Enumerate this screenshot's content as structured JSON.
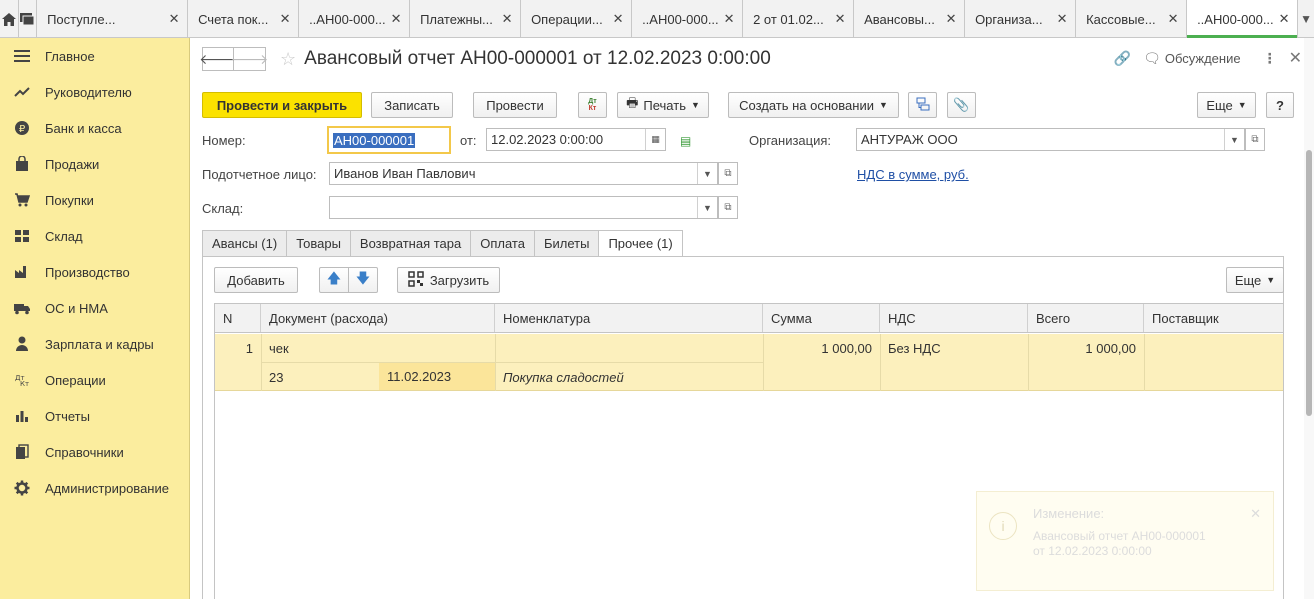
{
  "tabs": [
    {
      "label": "Поступле...",
      "width": 150
    },
    {
      "label": "Счета пок...",
      "width": 110
    },
    {
      "label": "..АН00-000...",
      "width": 110
    },
    {
      "label": "Платежны...",
      "width": 110
    },
    {
      "label": "Операции...",
      "width": 110
    },
    {
      "label": "..АН00-000...",
      "width": 110
    },
    {
      "label": "2 от 01.02...",
      "width": 110
    },
    {
      "label": "Авансовы...",
      "width": 110
    },
    {
      "label": "Организа...",
      "width": 110
    },
    {
      "label": "Кассовые...",
      "width": 110
    },
    {
      "label": "..АН00-000...",
      "width": 110,
      "active": true
    }
  ],
  "sidebar": {
    "items": [
      {
        "label": "Главное",
        "icon": "menu-icon"
      },
      {
        "label": "Руководителю",
        "icon": "trend-icon"
      },
      {
        "label": "Банк и касса",
        "icon": "ruble-icon"
      },
      {
        "label": "Продажи",
        "icon": "bag-icon"
      },
      {
        "label": "Покупки",
        "icon": "cart-icon"
      },
      {
        "label": "Склад",
        "icon": "warehouse-icon"
      },
      {
        "label": "Производство",
        "icon": "factory-icon"
      },
      {
        "label": "ОС и НМА",
        "icon": "truck-icon"
      },
      {
        "label": "Зарплата и кадры",
        "icon": "person-icon"
      },
      {
        "label": "Операции",
        "icon": "dt-kt-icon"
      },
      {
        "label": "Отчеты",
        "icon": "bar-chart-icon"
      },
      {
        "label": "Справочники",
        "icon": "books-icon"
      },
      {
        "label": "Администрирование",
        "icon": "gear-icon"
      }
    ]
  },
  "header": {
    "title": "Авансовый отчет АН00-000001 от 12.02.2023 0:00:00",
    "discuss": "Обсуждение"
  },
  "toolbar": {
    "post_close": "Провести и закрыть",
    "save": "Записать",
    "post": "Провести",
    "dt_kt": "Дт Кт",
    "print": "Печать",
    "create_based": "Создать на основании",
    "more": "Еще",
    "help": "?"
  },
  "form": {
    "number_label": "Номер:",
    "number_value": "АН00-000001",
    "date_label": "от:",
    "date_value": "12.02.2023  0:00:00",
    "org_label": "Организация:",
    "org_value": "АНТУРАЖ ООО",
    "person_label": "Подотчетное лицо:",
    "person_value": "Иванов Иван Павлович",
    "vat_link": "НДС в сумме, руб.",
    "warehouse_label": "Склад:",
    "warehouse_value": ""
  },
  "doc_tabs": [
    "Авансы (1)",
    "Товары",
    "Возвратная тара",
    "Оплата",
    "Билеты",
    "Прочее (1)"
  ],
  "active_doc_tab": 5,
  "table_toolbar": {
    "add": "Добавить",
    "load": "Загрузить",
    "more": "Еще"
  },
  "table": {
    "columns": [
      "N",
      "Документ (расхода)",
      "Номенклатура",
      "Сумма",
      "НДС",
      "Всего",
      "Поставщик"
    ],
    "rows": [
      {
        "n": "1",
        "doc": "чек",
        "doc_number": "23",
        "doc_date": "11.02.2023",
        "nomenclature": "",
        "nomenclature_note": "Покупка сладостей",
        "sum": "1 000,00",
        "vat": "Без НДС",
        "total": "1 000,00",
        "supplier": ""
      }
    ]
  },
  "notification": {
    "title": "Изменение:",
    "text_line1": "Авансовый отчет АН00-000001",
    "text_line2": "от 12.02.2023 0:00:00"
  }
}
